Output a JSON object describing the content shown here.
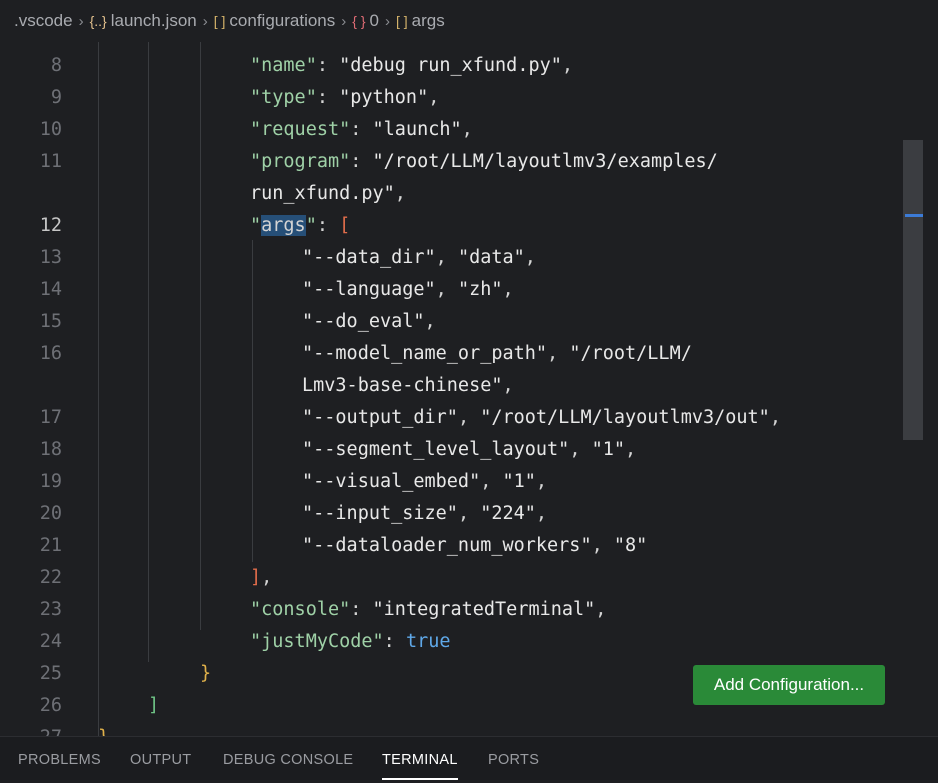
{
  "breadcrumb": {
    "items": [
      {
        "icon": "",
        "label": ".vscode"
      },
      {
        "icon": "{..}",
        "label": "launch.json"
      },
      {
        "icon": "[ ]",
        "label": "configurations"
      },
      {
        "icon": "{ }",
        "label": "0"
      },
      {
        "icon": "[ ]",
        "label": "args"
      }
    ]
  },
  "editor": {
    "lines": [
      {
        "num": "8",
        "parts": [
          [
            "key",
            "\"name\""
          ],
          [
            "pun",
            ": "
          ],
          [
            "str",
            "\"debug run_xfund.py\""
          ],
          [
            "pun",
            ","
          ]
        ]
      },
      {
        "num": "9",
        "parts": [
          [
            "key",
            "\"type\""
          ],
          [
            "pun",
            ": "
          ],
          [
            "str",
            "\"python\""
          ],
          [
            "pun",
            ","
          ]
        ]
      },
      {
        "num": "10",
        "parts": [
          [
            "key",
            "\"request\""
          ],
          [
            "pun",
            ": "
          ],
          [
            "str",
            "\"launch\""
          ],
          [
            "pun",
            ","
          ]
        ]
      },
      {
        "num": "11",
        "parts": [
          [
            "key",
            "\"program\""
          ],
          [
            "pun",
            ": "
          ],
          [
            "str",
            "\"/root/LLM/layoutlmv3/examples/"
          ]
        ]
      },
      {
        "num": "",
        "parts": [
          [
            "str",
            "run_xfund.py\""
          ],
          [
            "pun",
            ","
          ]
        ]
      },
      {
        "num": "12",
        "parts": [
          [
            "key",
            "\""
          ],
          [
            "sel",
            "args"
          ],
          [
            "key",
            "\""
          ],
          [
            "pun",
            ": "
          ],
          [
            "br3",
            "["
          ]
        ]
      },
      {
        "num": "13",
        "parts": [
          [
            "str",
            "\"--data_dir\""
          ],
          [
            "pun",
            ", "
          ],
          [
            "str",
            "\"data\""
          ],
          [
            "pun",
            ","
          ]
        ]
      },
      {
        "num": "14",
        "parts": [
          [
            "str",
            "\"--language\""
          ],
          [
            "pun",
            ", "
          ],
          [
            "str",
            "\"zh\""
          ],
          [
            "pun",
            ","
          ]
        ]
      },
      {
        "num": "15",
        "parts": [
          [
            "str",
            "\"--do_eval\""
          ],
          [
            "pun",
            ","
          ]
        ]
      },
      {
        "num": "16",
        "parts": [
          [
            "str",
            "\"--model_name_or_path\""
          ],
          [
            "pun",
            ", "
          ],
          [
            "str",
            "\"/root/LLM/"
          ]
        ]
      },
      {
        "num": "",
        "parts": [
          [
            "str",
            "Lmv3-base-chinese\""
          ],
          [
            "pun",
            ","
          ]
        ]
      },
      {
        "num": "17",
        "parts": [
          [
            "str",
            "\"--output_dir\""
          ],
          [
            "pun",
            ", "
          ],
          [
            "str",
            "\"/root/LLM/layoutlmv3/out\""
          ],
          [
            "pun",
            ","
          ]
        ]
      },
      {
        "num": "18",
        "parts": [
          [
            "str",
            "\"--segment_level_layout\""
          ],
          [
            "pun",
            ", "
          ],
          [
            "str",
            "\"1\""
          ],
          [
            "pun",
            ","
          ]
        ]
      },
      {
        "num": "19",
        "parts": [
          [
            "str",
            "\"--visual_embed\""
          ],
          [
            "pun",
            ", "
          ],
          [
            "str",
            "\"1\""
          ],
          [
            "pun",
            ","
          ]
        ]
      },
      {
        "num": "20",
        "parts": [
          [
            "str",
            "\"--input_size\""
          ],
          [
            "pun",
            ", "
          ],
          [
            "str",
            "\"224\""
          ],
          [
            "pun",
            ","
          ]
        ]
      },
      {
        "num": "21",
        "parts": [
          [
            "str",
            "\"--dataloader_num_workers\""
          ],
          [
            "pun",
            ", "
          ],
          [
            "str",
            "\"8\""
          ]
        ]
      },
      {
        "num": "22",
        "parts": [
          [
            "br3",
            "]"
          ],
          [
            "pun",
            ","
          ]
        ]
      },
      {
        "num": "23",
        "parts": [
          [
            "key",
            "\"console\""
          ],
          [
            "pun",
            ": "
          ],
          [
            "str",
            "\"integratedTerminal\""
          ],
          [
            "pun",
            ","
          ]
        ]
      },
      {
        "num": "24",
        "parts": [
          [
            "key",
            "\"justMyCode\""
          ],
          [
            "pun",
            ": "
          ],
          [
            "kw",
            "true"
          ]
        ]
      },
      {
        "num": "25",
        "parts": [
          [
            "br1",
            "}"
          ]
        ]
      },
      {
        "num": "26",
        "parts": [
          [
            "br2",
            "]"
          ]
        ]
      },
      {
        "num": "27",
        "parts": [
          [
            "br1",
            "}"
          ]
        ]
      }
    ],
    "active_line": "12",
    "add_config_label": "Add Configuration..."
  },
  "panel": {
    "tabs": [
      {
        "label": "PROBLEMS",
        "active": false
      },
      {
        "label": "OUTPUT",
        "active": false
      },
      {
        "label": "DEBUG CONSOLE",
        "active": false
      },
      {
        "label": "TERMINAL",
        "active": true
      },
      {
        "label": "PORTS",
        "active": false
      }
    ]
  },
  "colors": {
    "key": "#9fd1a7",
    "string": "#e8e8e8",
    "keyword": "#5fa8e8",
    "button": "#2a8a38",
    "selection": "#264f78"
  }
}
